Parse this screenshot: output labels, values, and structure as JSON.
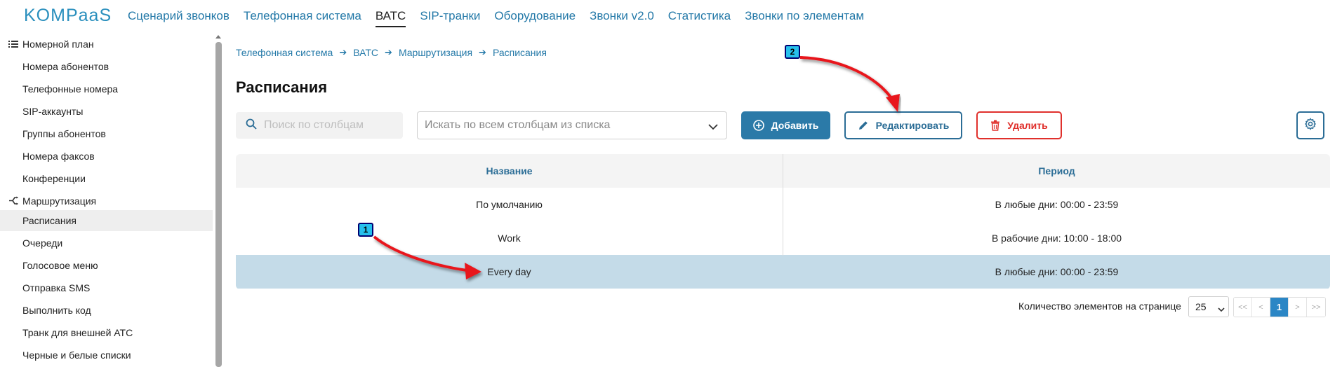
{
  "logo": {
    "text_main": "KOMP",
    "text_mid": "aa",
    "text_end": "S"
  },
  "nav": [
    {
      "label": "Сценарий звонков"
    },
    {
      "label": "Телефонная система"
    },
    {
      "label": "ВАТС"
    },
    {
      "label": "SIP-транки"
    },
    {
      "label": "Оборудование"
    },
    {
      "label": "Звонки v2.0"
    },
    {
      "label": "Статистика"
    },
    {
      "label": "Звонки по элементам"
    }
  ],
  "nav_active": "ВАТС",
  "sidebar": {
    "items": [
      {
        "label": "Номерной план",
        "kind": "group",
        "icon": "list-icon"
      },
      {
        "label": "Номера абонентов",
        "kind": "child"
      },
      {
        "label": "Телефонные номера",
        "kind": "child"
      },
      {
        "label": "SIP-аккаунты",
        "kind": "child"
      },
      {
        "label": "Группы абонентов",
        "kind": "child"
      },
      {
        "label": "Номера факсов",
        "kind": "child"
      },
      {
        "label": "Конференции",
        "kind": "child"
      },
      {
        "label": "Маршрутизация",
        "kind": "group",
        "icon": "routing-icon"
      },
      {
        "label": "Расписания",
        "kind": "child",
        "selected": true
      },
      {
        "label": "Очереди",
        "kind": "child"
      },
      {
        "label": "Голосовое меню",
        "kind": "child"
      },
      {
        "label": "Отправка SMS",
        "kind": "child"
      },
      {
        "label": "Выполнить код",
        "kind": "child"
      },
      {
        "label": "Транк для внешней АТС",
        "kind": "child"
      },
      {
        "label": "Черные и белые списки",
        "kind": "child"
      }
    ]
  },
  "breadcrumb": [
    "Телефонная система",
    "ВАТС",
    "Маршрутизация",
    "Расписания"
  ],
  "page_title": "Расписания",
  "toolbar": {
    "search_placeholder": "Поиск по столбцам",
    "select_placeholder": "Искать по всем столбцам из списка",
    "add_label": "Добавить",
    "edit_label": "Редактировать",
    "delete_label": "Удалить"
  },
  "table": {
    "columns": [
      "Название",
      "Период"
    ],
    "rows": [
      {
        "name": "По умолчанию",
        "period": "В любые дни: 00:00 - 23:59"
      },
      {
        "name": "Work",
        "period": "В рабочие дни: 10:00 - 18:00"
      },
      {
        "name": "Every day",
        "period": "В любые дни: 00:00 - 23:59",
        "selected": true
      }
    ]
  },
  "pagination": {
    "label": "Количество элементов на странице",
    "page_size": "25",
    "first": "<<",
    "prev": "<",
    "current": "1",
    "next": ">",
    "last": ">>"
  },
  "annotations": [
    {
      "number": "1"
    },
    {
      "number": "2"
    }
  ],
  "colors": {
    "brand": "#2a8fbd",
    "link": "#2479a8",
    "primary_button": "#2b7aa8",
    "danger": "#e0302c",
    "selected_row": "#c4dbe8",
    "annotation_arrow": "#e8141b",
    "annotation_badge": "#27c0ec"
  }
}
